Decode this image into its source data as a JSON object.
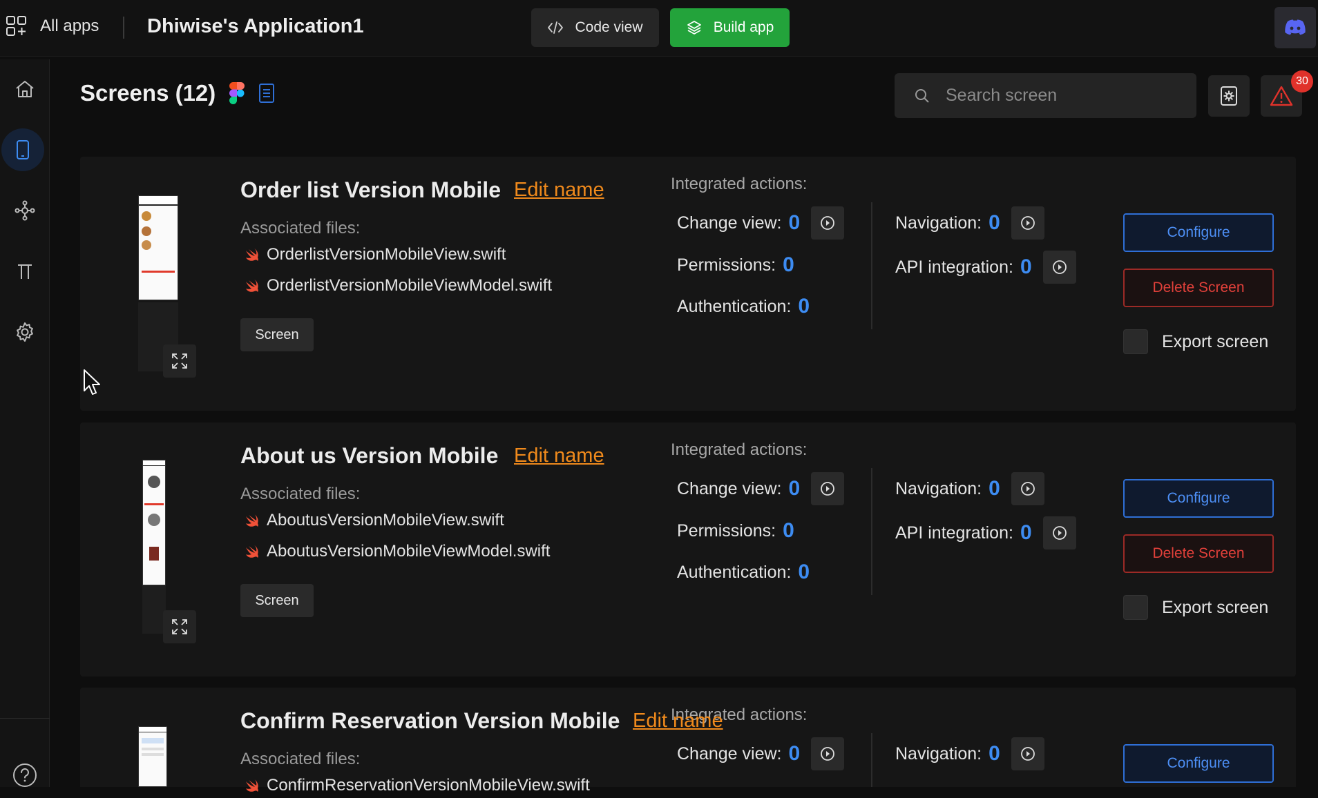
{
  "topbar": {
    "all_apps_label": "All apps",
    "app_title": "Dhiwise's Application1",
    "code_view_label": "Code view",
    "build_app_label": "Build app"
  },
  "sidebar": {
    "items": [
      "home-icon",
      "mobile-screen-icon",
      "integrations-icon",
      "typography-icon",
      "settings-icon"
    ],
    "help": "help-icon"
  },
  "header": {
    "title": "Screens (12)",
    "search_placeholder": "Search screen",
    "alert_count": "30"
  },
  "labels": {
    "edit_name": "Edit name",
    "associated_files": "Associated files:",
    "screen_tag": "Screen",
    "integrated_actions": "Integrated actions:",
    "change_view": "Change view:",
    "navigation": "Navigation:",
    "permissions": "Permissions:",
    "api_integration": "API integration:",
    "authentication": "Authentication:",
    "configure": "Configure",
    "delete_screen": "Delete Screen",
    "export_screen": "Export screen"
  },
  "screens": [
    {
      "name": "Order list Version Mobile",
      "files": [
        "OrderlistVersionMobileView.swift",
        "OrderlistVersionMobileViewModel.swift"
      ],
      "change_view": "0",
      "navigation": "0",
      "permissions": "0",
      "api_integration": "0",
      "authentication": "0"
    },
    {
      "name": "About us Version Mobile",
      "files": [
        "AboutusVersionMobileView.swift",
        "AboutusVersionMobileViewModel.swift"
      ],
      "change_view": "0",
      "navigation": "0",
      "permissions": "0",
      "api_integration": "0",
      "authentication": "0"
    },
    {
      "name": "Confirm Reservation Version Mobile",
      "files": [
        "ConfirmReservationVersionMobileView.swift"
      ],
      "change_view": "0",
      "navigation": "0"
    }
  ],
  "colors": {
    "accent_blue": "#3d8cf2",
    "build_green": "#23a33b",
    "edit_orange": "#f08a1c",
    "danger_red": "#e0403a"
  }
}
